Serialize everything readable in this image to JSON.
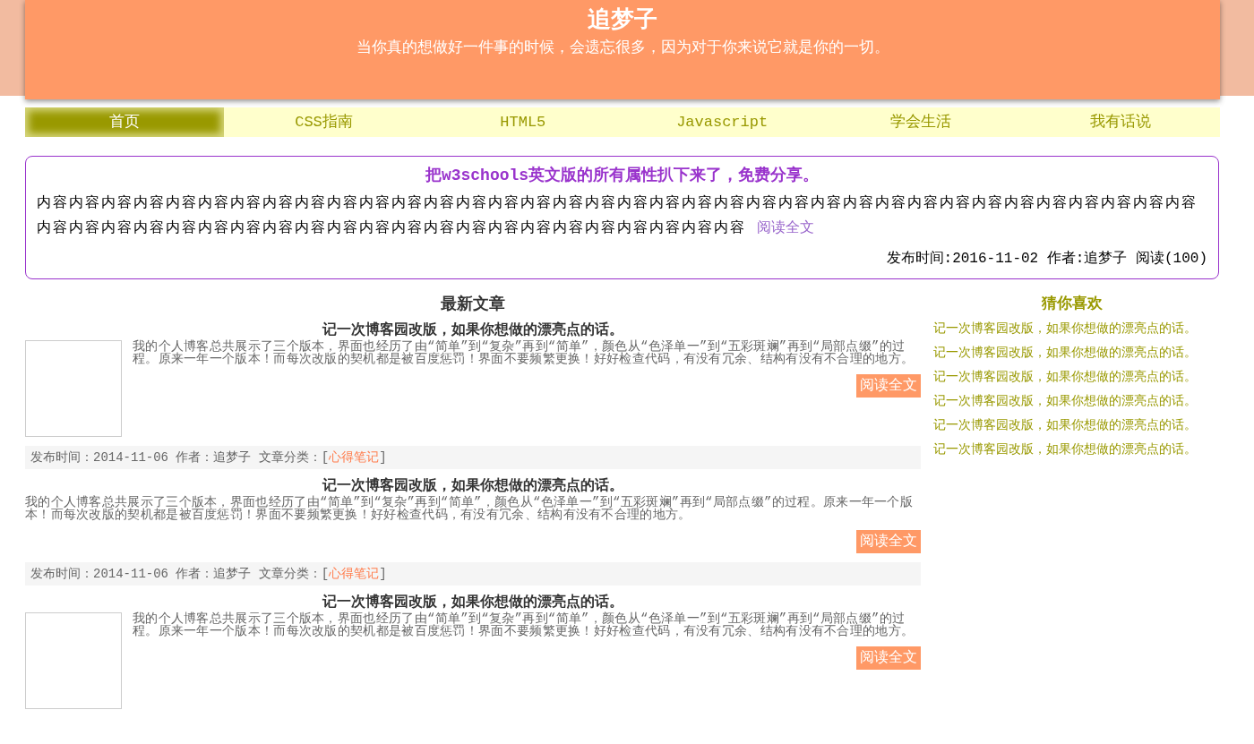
{
  "header": {
    "title": "追梦子",
    "motto": "当你真的想做好一件事的时候，会遗忘很多，因为对于你来说它就是你的一切。"
  },
  "nav": [
    {
      "label": "首页",
      "selected": true
    },
    {
      "label": "CSS指南",
      "selected": false
    },
    {
      "label": "HTML5",
      "selected": false
    },
    {
      "label": "Javascript",
      "selected": false
    },
    {
      "label": "学会生活",
      "selected": false
    },
    {
      "label": "我有话说",
      "selected": false
    }
  ],
  "featured": {
    "title": "把w3schools英文版的所有属性扒下来了，免费分享。",
    "body": "内容内容内容内容内容内容内容内容内容内容内容内容内容内容内容内容内容内容内容内容内容内容内容内容内容内容内容内容内容内容内容内容内容内容内容内容内容内容内容内容内容内容内容内容内容内容内容内容内容内容内容内容内容内容内容内容内容内容",
    "link": "阅读全文",
    "meta": "发布时间:2016-11-02 作者:追梦子 阅读(100)"
  },
  "latest": {
    "heading": "最新文章",
    "articles": [
      {
        "kind": "thumbnail",
        "title": "记一次博客园改版，如果你想做的漂亮点的话。",
        "summary": "我的个人博客总共展示了三个版本，界面也经历了由“简单”到“复杂”再到“简单”，颜色从“色泽单一”到“五彩斑斓”再到“局部点缀”的过程。原来一年一个版本！而每次改版的契机都是被百度惩罚！界面不要频繁更换！好好检查代码，有没有冗余、结构有没有不合理的地方。",
        "button": "阅读全文",
        "meta": "发布时间：2014-11-06 作者：追梦子 文章分类：[",
        "category": "心得笔记",
        "meta_end": "]"
      },
      {
        "kind": "text",
        "title": "记一次博客园改版，如果你想做的漂亮点的话。",
        "summary": "我的个人博客总共展示了三个版本，界面也经历了由“简单”到“复杂”再到“简单”，颜色从“色泽单一”到“五彩斑斓”再到“局部点缀”的过程。原来一年一个版本！而每次改版的契机都是被百度惩罚！界面不要频繁更换！好好检查代码，有没有冗余、结构有没有不合理的地方。",
        "button": "阅读全文",
        "meta": "发布时间：2014-11-06 作者：追梦子 文章分类：[",
        "category": "心得笔记",
        "meta_end": "]"
      },
      {
        "kind": "thumbnail",
        "title": "记一次博客园改版，如果你想做的漂亮点的话。",
        "summary": "我的个人博客总共展示了三个版本，界面也经历了由“简单”到“复杂”再到“简单”，颜色从“色泽单一”到“五彩斑斓”再到“局部点缀”的过程。原来一年一个版本！而每次改版的契机都是被百度惩罚！界面不要频繁更换！好好检查代码，有没有冗余、结构有没有不合理的地方。",
        "button": "阅读全文"
      }
    ]
  },
  "sidebar": {
    "heading": "猜你喜欢",
    "items": [
      "记一次博客园改版，如果你想做的漂亮点的话。",
      "记一次博客园改版，如果你想做的漂亮点的话。",
      "记一次博客园改版，如果你想做的漂亮点的话。",
      "记一次博客园改版，如果你想做的漂亮点的话。",
      "记一次博客园改版，如果你想做的漂亮点的话。",
      "记一次博客园改版，如果你想做的漂亮点的话。"
    ]
  }
}
